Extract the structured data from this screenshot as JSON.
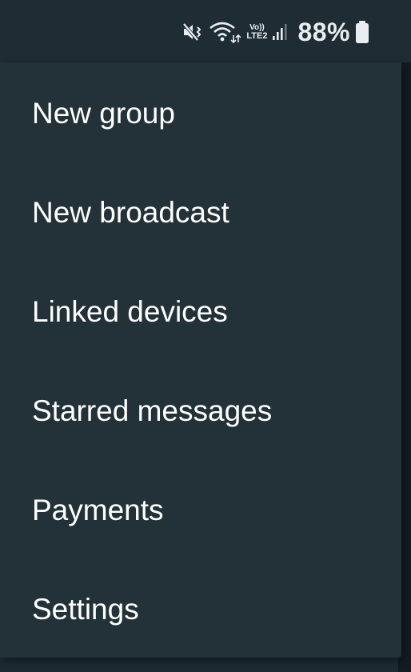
{
  "status_bar": {
    "battery_percent": "88%",
    "volte_label": "Vo))",
    "lte_label": "LTE2",
    "icons": [
      "mute-vibrate-icon",
      "wifi-icon",
      "cellular-signal-icon",
      "battery-icon"
    ]
  },
  "menu": {
    "items": [
      {
        "label": "New group"
      },
      {
        "label": "New broadcast"
      },
      {
        "label": "Linked devices"
      },
      {
        "label": "Starred messages"
      },
      {
        "label": "Payments"
      },
      {
        "label": "Settings"
      }
    ]
  },
  "colors": {
    "menu_background": "#233138",
    "status_bar_background": "#1f2c33",
    "text": "#ffffff",
    "accent": "#21a366"
  }
}
